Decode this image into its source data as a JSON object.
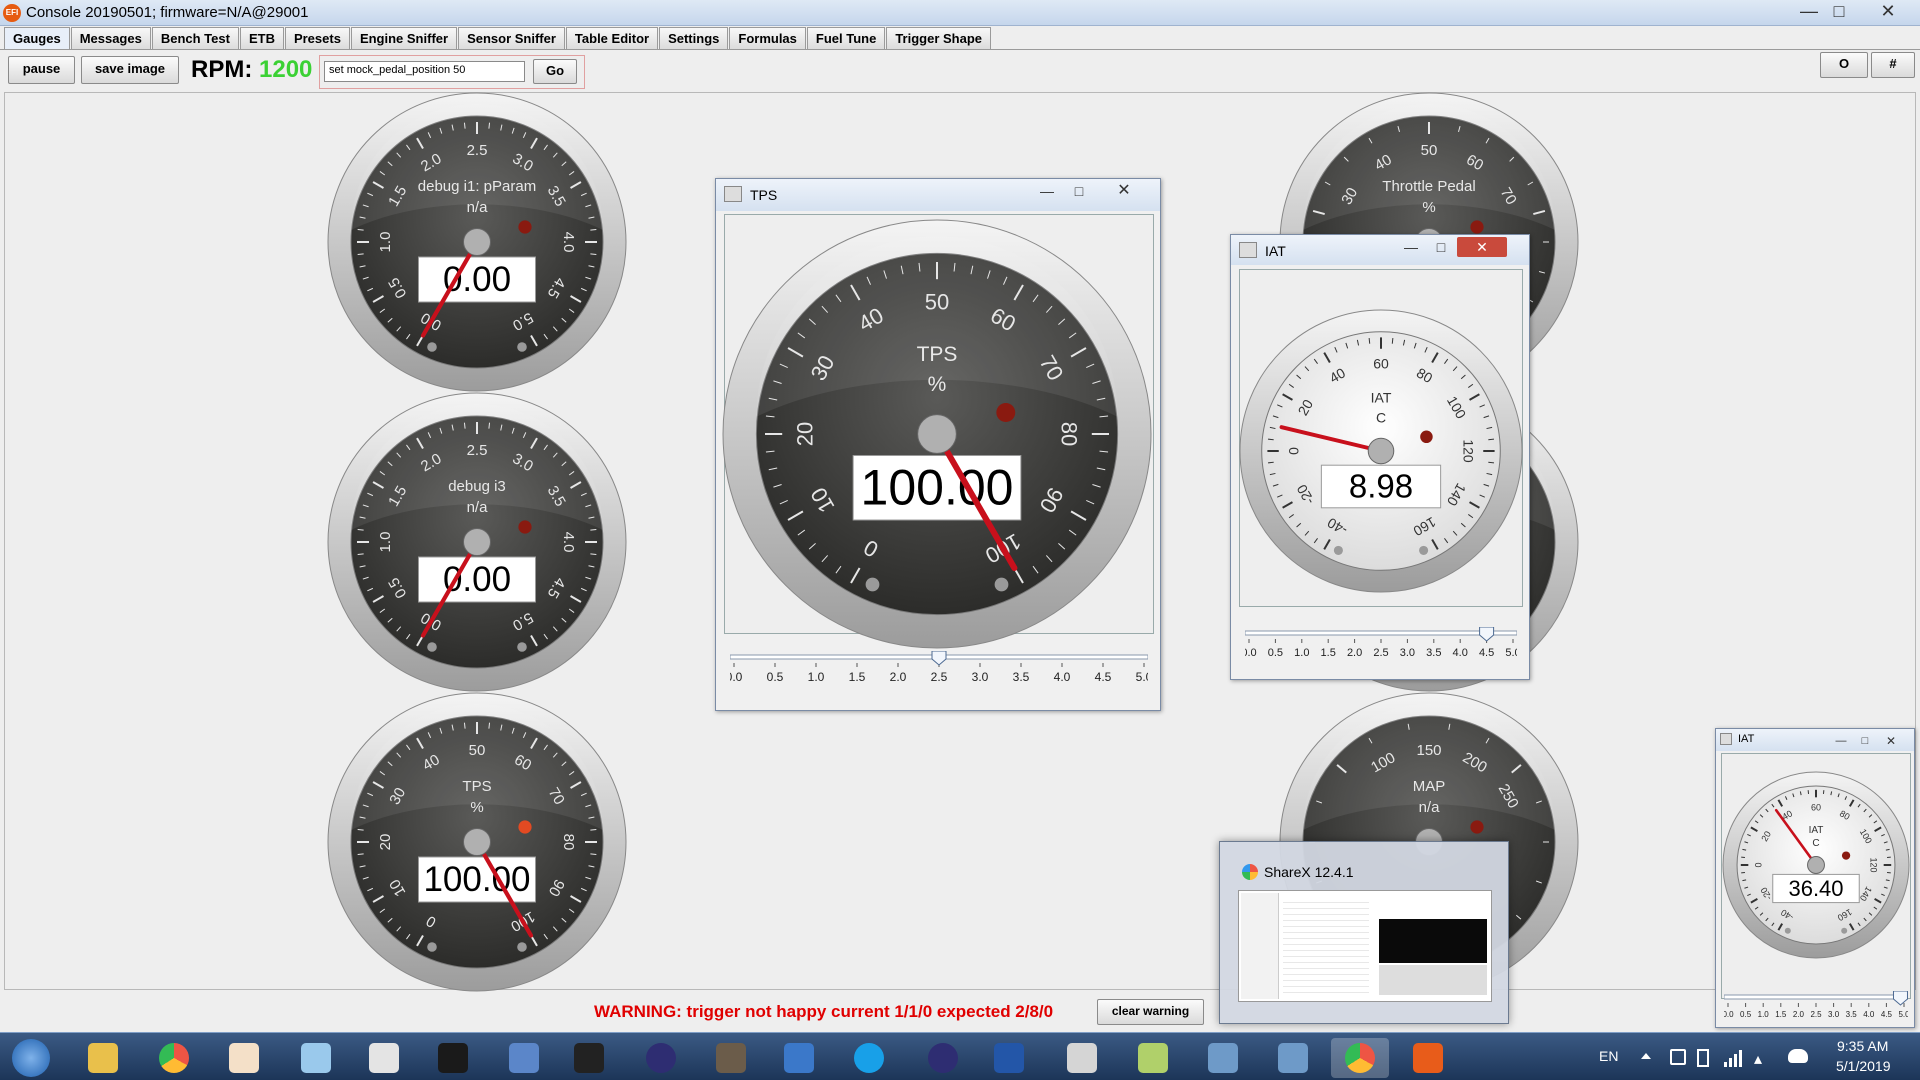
{
  "window": {
    "title": "Console 20190501; firmware=N/A@29001",
    "app_icon": "EFI",
    "controls": [
      "—",
      "□",
      "✕"
    ]
  },
  "tabs": [
    "Gauges",
    "Messages",
    "Bench Test",
    "ETB",
    "Presets",
    "Engine Sniffer",
    "Sensor Sniffer",
    "Table Editor",
    "Settings",
    "Formulas",
    "Fuel Tune",
    "Trigger Shape"
  ],
  "active_tab": "Gauges",
  "toolbar": {
    "pause_label": "pause",
    "save_image_label": "save image",
    "rpm_label": "RPM:",
    "rpm_value": "1200",
    "command_value": "set mock_pedal_position 50",
    "go_label": "Go",
    "o_label": "O",
    "hash_label": "#"
  },
  "gauges": {
    "debug_i1": {
      "title": "debug i1: pParam",
      "unit": "n/a",
      "value": "0.00",
      "ticks": [
        "0.0",
        "0.5",
        "1.0",
        "1.5",
        "2.0",
        "2.5",
        "3.0",
        "3.5",
        "4.0",
        "4.5",
        "5.0"
      ]
    },
    "debug_i3": {
      "title": "debug i3",
      "unit": "n/a",
      "value": "0.00",
      "ticks": [
        "0.0",
        "0.5",
        "1.0",
        "1.5",
        "2.0",
        "2.5",
        "3.0",
        "3.5",
        "4.0",
        "4.5",
        "5.0"
      ]
    },
    "tps_small": {
      "title": "TPS",
      "unit": "%",
      "value": "100.00",
      "ticks": [
        "0",
        "10",
        "20",
        "30",
        "40",
        "50",
        "60",
        "70",
        "80",
        "90",
        "100"
      ]
    },
    "throttle_pedal": {
      "title": "Throttle Pedal",
      "unit": "%",
      "ticks": [
        "30",
        "40",
        "50",
        "60",
        "70"
      ]
    },
    "map": {
      "title": "MAP",
      "unit": "n/a",
      "ticks": [
        "100",
        "150",
        "200",
        "250"
      ]
    }
  },
  "tps_window": {
    "title": "TPS",
    "gauge_title": "TPS",
    "unit": "%",
    "value": "100.00",
    "ticks": [
      "0",
      "10",
      "20",
      "30",
      "40",
      "50",
      "60",
      "70",
      "80",
      "90",
      "100"
    ],
    "slider_ticks": [
      "0.0",
      "0.5",
      "1.0",
      "1.5",
      "2.0",
      "2.5",
      "3.0",
      "3.5",
      "4.0",
      "4.5",
      "5.0"
    ],
    "slider_position": 0.5
  },
  "iat_window": {
    "title": "IAT",
    "gauge_title": "IAT",
    "unit": "C",
    "value": "8.98",
    "ticks": [
      "-40",
      "-20",
      "0",
      "20",
      "40",
      "60",
      "80",
      "100",
      "120",
      "140",
      "160"
    ],
    "slider_ticks": [
      "0.0",
      "0.5",
      "1.0",
      "1.5",
      "2.0",
      "2.5",
      "3.0",
      "3.5",
      "4.0",
      "4.5",
      "5.0"
    ],
    "slider_position": 0.9
  },
  "iat_small_window": {
    "title": "IAT",
    "gauge_title": "IAT",
    "unit": "C",
    "value": "36.40",
    "ticks": [
      "-40",
      "-20",
      "0",
      "20",
      "40",
      "60",
      "80",
      "100",
      "120",
      "140",
      "160"
    ],
    "slider_ticks": [
      "0.0",
      "0.5",
      "1.0",
      "1.5",
      "2.0",
      "2.5",
      "3.0",
      "3.5",
      "4.0",
      "4.5",
      "5.0"
    ],
    "slider_position": 0.98
  },
  "sharex_preview": {
    "title": "ShareX 12.4.1"
  },
  "warning": {
    "text": "WARNING: trigger not happy current 1/1/0 expected 2/8/0",
    "clear_label": "clear warning"
  },
  "taskbar": {
    "apps": [
      "start-orb",
      "file-explorer",
      "chrome",
      "pdf-tool",
      "notepad",
      "paint",
      "movie-maker",
      "network",
      "intellij",
      "eclipse",
      "gimp",
      "virtualbox",
      "skype",
      "eclipse-2",
      "database",
      "git",
      "paint-net",
      "remote-desktop",
      "remote-2",
      "sharex",
      "rusefi-console"
    ],
    "language": "EN",
    "time": "9:35 AM",
    "date": "5/1/2019"
  }
}
